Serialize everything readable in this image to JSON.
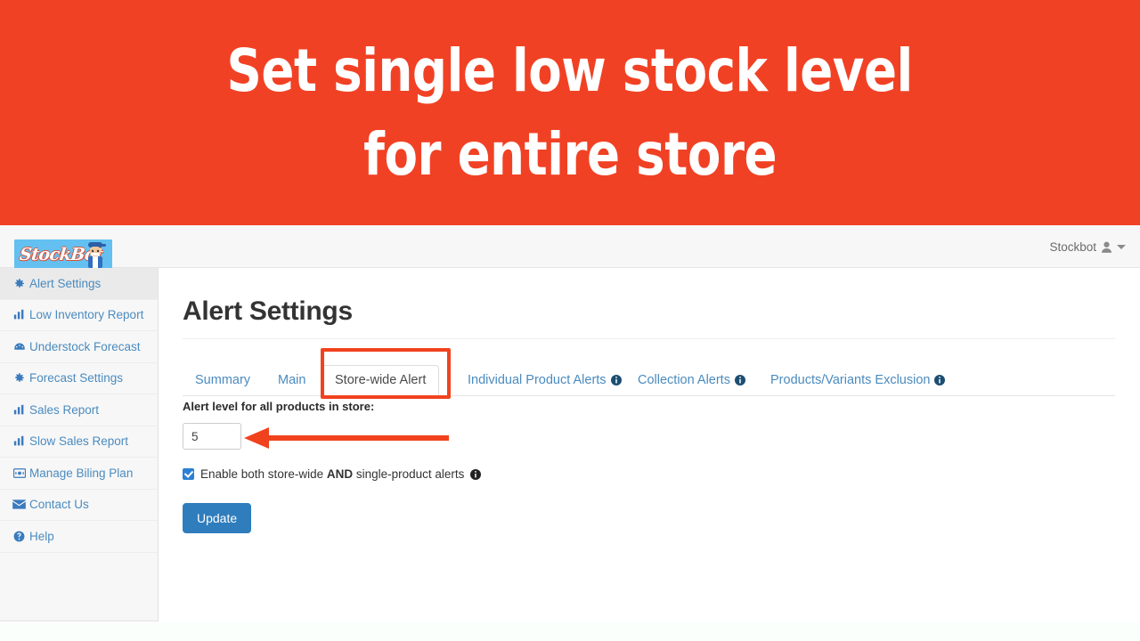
{
  "banner": {
    "line1": "Set single low stock level",
    "line2": "for entire store",
    "bg_color": "#f14124",
    "text_color": "#ffffff"
  },
  "header": {
    "logo_text": "StockBot",
    "logo_icon": "stockbot-mascot-icon",
    "user_name": "Stockbot",
    "user_icon": "user-icon",
    "caret_icon": "chevron-down-icon"
  },
  "sidebar": {
    "items": [
      {
        "label": "Alert Settings",
        "icon": "gear-icon",
        "active": true
      },
      {
        "label": "Low Inventory Report",
        "icon": "bar-chart-icon",
        "active": false
      },
      {
        "label": "Understock Forecast",
        "icon": "dashboard-icon",
        "active": false
      },
      {
        "label": "Forecast Settings",
        "icon": "gear-icon",
        "active": false
      },
      {
        "label": "Sales Report",
        "icon": "bar-chart-icon",
        "active": false
      },
      {
        "label": "Slow Sales Report",
        "icon": "bar-chart-icon",
        "active": false
      },
      {
        "label": "Manage Biling Plan",
        "icon": "billing-card-icon",
        "active": false
      },
      {
        "label": "Contact Us",
        "icon": "envelope-icon",
        "active": false
      },
      {
        "label": "Help",
        "icon": "question-circle-icon",
        "active": false
      }
    ]
  },
  "main": {
    "title": "Alert Settings",
    "tabs": [
      {
        "label": "Summary",
        "info": false,
        "active": false
      },
      {
        "label": "Main",
        "info": false,
        "active": false
      },
      {
        "label": "Store-wide Alert",
        "info": false,
        "active": true
      },
      {
        "label": "Individual Product Alerts",
        "info": true,
        "active": false
      },
      {
        "label": "Collection Alerts",
        "info": true,
        "active": false
      },
      {
        "label": "Products/Variants Exclusion",
        "info": true,
        "active": false
      }
    ],
    "form": {
      "alert_level_label": "Alert level for all products in store:",
      "alert_level_value": "5",
      "alert_level_placeholder": "",
      "checkbox_checked": true,
      "checkbox_text_before": "Enable both store-wide ",
      "checkbox_text_bold": "AND",
      "checkbox_text_after": " single-product alerts",
      "checkbox_info_icon": "info-icon",
      "update_label": "Update"
    }
  },
  "annotations": {
    "highlight_color": "#f1421e",
    "arrow_color": "#f1421e",
    "highlight_target": "Store-wide Alert",
    "arrow_target": "alert-level-input"
  }
}
